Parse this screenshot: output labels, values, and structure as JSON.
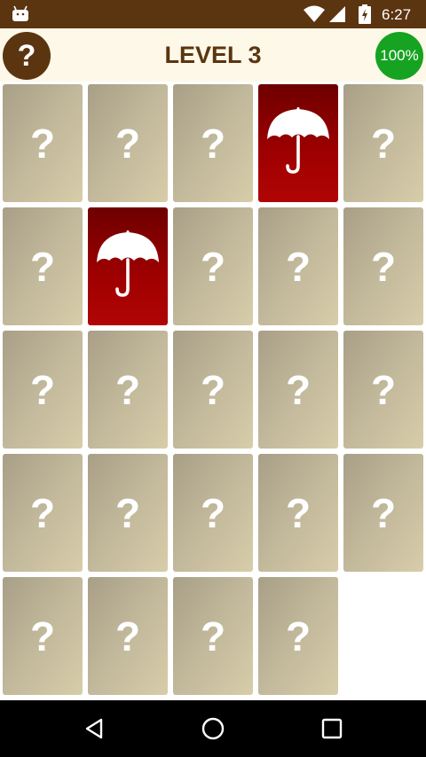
{
  "status_bar": {
    "time": "6:27",
    "icons": [
      "android-icon",
      "wifi-icon",
      "cell-signal-icon",
      "battery-charging-icon"
    ]
  },
  "header": {
    "help_label": "?",
    "title": "LEVEL 3",
    "progress": "100%"
  },
  "colors": {
    "brown": "#5b3410",
    "header_bg": "#fdf8e8",
    "progress_green": "#16a321",
    "card_hidden": "#c2b89b",
    "card_revealed": "#a00000"
  },
  "cards": [
    {
      "state": "hidden",
      "label": "?"
    },
    {
      "state": "hidden",
      "label": "?"
    },
    {
      "state": "hidden",
      "label": "?"
    },
    {
      "state": "revealed",
      "icon": "umbrella-icon"
    },
    {
      "state": "hidden",
      "label": "?"
    },
    {
      "state": "hidden",
      "label": "?"
    },
    {
      "state": "revealed",
      "icon": "umbrella-icon"
    },
    {
      "state": "hidden",
      "label": "?"
    },
    {
      "state": "hidden",
      "label": "?"
    },
    {
      "state": "hidden",
      "label": "?"
    },
    {
      "state": "hidden",
      "label": "?"
    },
    {
      "state": "hidden",
      "label": "?"
    },
    {
      "state": "hidden",
      "label": "?"
    },
    {
      "state": "hidden",
      "label": "?"
    },
    {
      "state": "hidden",
      "label": "?"
    },
    {
      "state": "hidden",
      "label": "?"
    },
    {
      "state": "hidden",
      "label": "?"
    },
    {
      "state": "hidden",
      "label": "?"
    },
    {
      "state": "hidden",
      "label": "?"
    },
    {
      "state": "hidden",
      "label": "?"
    },
    {
      "state": "hidden",
      "label": "?"
    },
    {
      "state": "hidden",
      "label": "?"
    },
    {
      "state": "hidden",
      "label": "?"
    },
    {
      "state": "hidden",
      "label": "?"
    }
  ],
  "nav_bar": {
    "buttons": [
      "back-icon",
      "home-icon",
      "recents-icon"
    ]
  }
}
